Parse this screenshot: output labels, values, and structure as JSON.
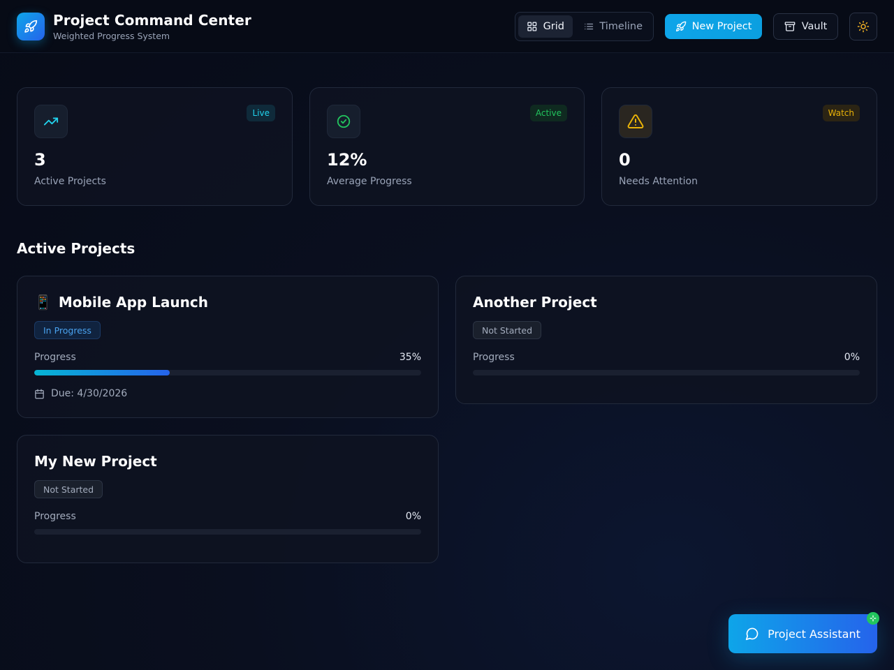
{
  "header": {
    "title": "Project Command Center",
    "subtitle": "Weighted Progress System",
    "view_toggle": {
      "grid_label": "Grid",
      "timeline_label": "Timeline",
      "active": "Grid"
    },
    "new_project_label": "New Project",
    "vault_label": "Vault"
  },
  "stats": [
    {
      "value": "3",
      "label": "Active Projects",
      "badge": "Live",
      "icon": "trending-up-icon",
      "accent": "#22d3ee"
    },
    {
      "value": "12%",
      "label": "Average Progress",
      "badge": "Active",
      "icon": "check-circle-icon",
      "accent": "#22c55e"
    },
    {
      "value": "0",
      "label": "Needs Attention",
      "badge": "Watch",
      "icon": "warning-icon",
      "accent": "#eab308"
    }
  ],
  "section_title": "Active Projects",
  "projects": [
    {
      "emoji": "📱",
      "name": "Mobile App Launch",
      "status": "In Progress",
      "progress_label": "Progress",
      "progress_text": "35%",
      "progress": 0.35,
      "due": "Due: 4/30/2026"
    },
    {
      "name": "Another Project",
      "status": "Not Started",
      "progress_label": "Progress",
      "progress_text": "0%",
      "progress": 0
    },
    {
      "name": "My New Project",
      "status": "Not Started",
      "progress_label": "Progress",
      "progress_text": "0%",
      "progress": 0
    }
  ],
  "assistant": {
    "label": "Project Assistant"
  },
  "colors": {
    "accent": "#0ea5e9",
    "accent_end": "#2563eb",
    "background": "#0a0f1f"
  }
}
